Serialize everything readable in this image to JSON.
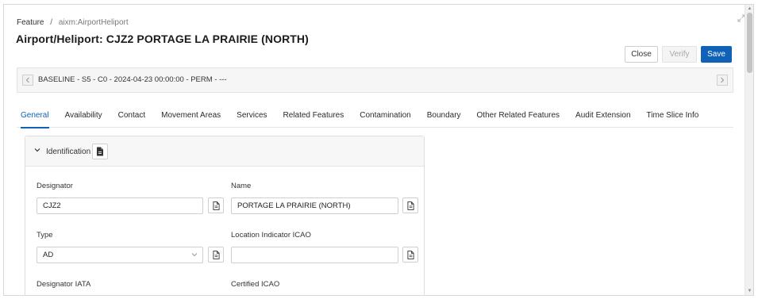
{
  "breadcrumb": {
    "items": [
      "Feature",
      "aixm:AirportHeliport"
    ],
    "separator": "/"
  },
  "page": {
    "title": "Airport/Heliport: CJZ2 PORTAGE LA PRAIRIE (NORTH)"
  },
  "toolbar": {
    "close_label": "Close",
    "verify_label": "Verify",
    "save_label": "Save"
  },
  "timeslice": {
    "label": "BASELINE - S5 - C0 - 2024-04-23 00:00:00 - PERM - ---",
    "prev_icon": "chevron-left-icon",
    "next_icon": "chevron-right-icon"
  },
  "tabs": [
    {
      "label": "General",
      "active": true
    },
    {
      "label": "Availability"
    },
    {
      "label": "Contact"
    },
    {
      "label": "Movement Areas"
    },
    {
      "label": "Services"
    },
    {
      "label": "Related Features"
    },
    {
      "label": "Contamination"
    },
    {
      "label": "Boundary"
    },
    {
      "label": "Other Related Features"
    },
    {
      "label": "Audit Extension"
    },
    {
      "label": "Time Slice Info"
    }
  ],
  "identification": {
    "title": "Identification",
    "fields": {
      "designator": {
        "label": "Designator",
        "value": "CJZ2"
      },
      "name": {
        "label": "Name",
        "value": "PORTAGE LA PRAIRIE (NORTH)"
      },
      "type": {
        "label": "Type",
        "value": "AD"
      },
      "location_indicator_icao": {
        "label": "Location Indicator ICAO",
        "value": ""
      },
      "designator_iata": {
        "label": "Designator IATA",
        "value": ""
      },
      "certified_icao": {
        "label": "Certified ICAO",
        "value": ""
      }
    }
  },
  "colors": {
    "accent": "#0f62b7",
    "border": "#cfcfcf",
    "panel_header_bg": "#f7f7f7"
  }
}
